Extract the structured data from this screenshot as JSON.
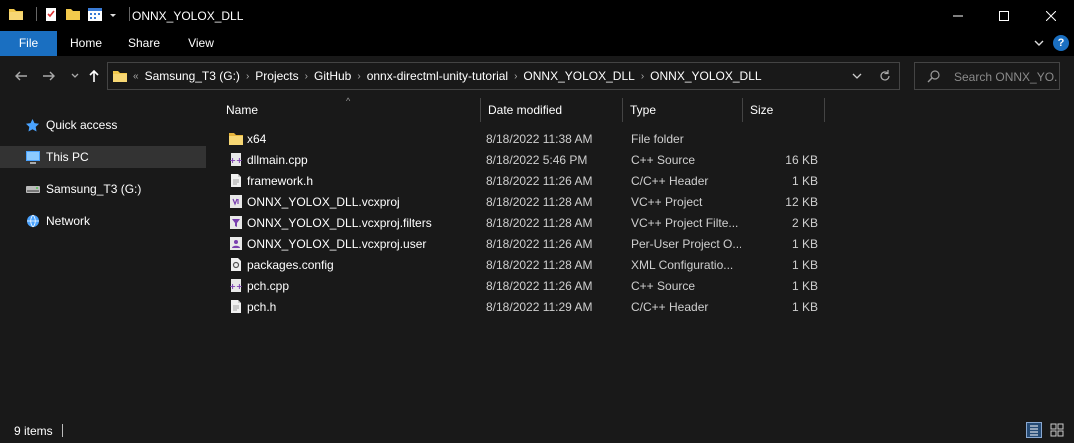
{
  "window": {
    "title": "ONNX_YOLOX_DLL"
  },
  "ribbon": {
    "tabs": [
      "File",
      "Home",
      "Share",
      "View"
    ],
    "help_label": "?"
  },
  "address": {
    "overflow_marker": "«",
    "breadcrumbs": [
      "Samsung_T3 (G:)",
      "Projects",
      "GitHub",
      "onnx-directml-unity-tutorial",
      "ONNX_YOLOX_DLL",
      "ONNX_YOLOX_DLL"
    ],
    "separator": "›"
  },
  "search": {
    "placeholder": "Search ONNX_YO..."
  },
  "sidebar": {
    "items": [
      {
        "label": "Quick access",
        "icon": "star-icon"
      },
      {
        "label": "This PC",
        "icon": "computer-icon",
        "selected": true
      },
      {
        "label": "Samsung_T3 (G:)",
        "icon": "drive-icon"
      },
      {
        "label": "Network",
        "icon": "network-icon"
      }
    ]
  },
  "columns": {
    "name": "Name",
    "date": "Date modified",
    "type": "Type",
    "size": "Size",
    "sort_indicator": "^"
  },
  "files": [
    {
      "name": "x64",
      "date": "8/18/2022 11:38 AM",
      "type": "File folder",
      "size": "",
      "icon": "folder-icon"
    },
    {
      "name": "dllmain.cpp",
      "date": "8/18/2022 5:46 PM",
      "type": "C++ Source",
      "size": "16 KB",
      "icon": "cpp-file-icon"
    },
    {
      "name": "framework.h",
      "date": "8/18/2022 11:26 AM",
      "type": "C/C++ Header",
      "size": "1 KB",
      "icon": "header-file-icon"
    },
    {
      "name": "ONNX_YOLOX_DLL.vcxproj",
      "date": "8/18/2022 11:28 AM",
      "type": "VC++ Project",
      "size": "12 KB",
      "icon": "vcxproj-file-icon"
    },
    {
      "name": "ONNX_YOLOX_DLL.vcxproj.filters",
      "date": "8/18/2022 11:28 AM",
      "type": "VC++ Project Filte...",
      "size": "2 KB",
      "icon": "filters-file-icon"
    },
    {
      "name": "ONNX_YOLOX_DLL.vcxproj.user",
      "date": "8/18/2022 11:26 AM",
      "type": "Per-User Project O...",
      "size": "1 KB",
      "icon": "user-file-icon"
    },
    {
      "name": "packages.config",
      "date": "8/18/2022 11:28 AM",
      "type": "XML Configuratio...",
      "size": "1 KB",
      "icon": "config-file-icon"
    },
    {
      "name": "pch.cpp",
      "date": "8/18/2022 11:26 AM",
      "type": "C++ Source",
      "size": "1 KB",
      "icon": "cpp-file-icon"
    },
    {
      "name": "pch.h",
      "date": "8/18/2022 11:29 AM",
      "type": "C/C++ Header",
      "size": "1 KB",
      "icon": "header-file-icon"
    }
  ],
  "status": {
    "item_count": "9 items"
  },
  "colors": {
    "accent": "#1a6fc1",
    "folder": "#f2c94c",
    "background": "#191919"
  }
}
